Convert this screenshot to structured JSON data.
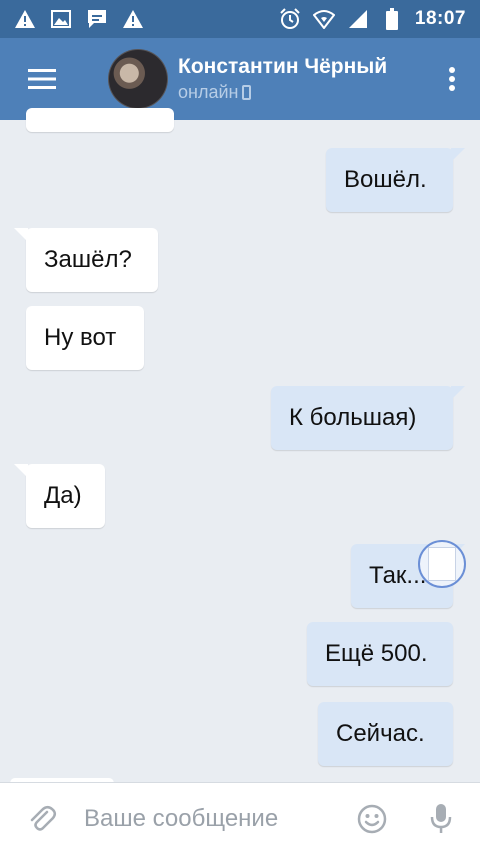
{
  "status_bar": {
    "time": "18:07",
    "left_icons": [
      "warning-icon",
      "image-icon",
      "message-icon",
      "warning-icon"
    ],
    "right_icons": [
      "alarm-icon",
      "wifi-icon",
      "signal-icon",
      "battery-icon"
    ]
  },
  "header": {
    "contact_name": "Константин Чёрный",
    "status": "онлайн",
    "background": "#4e80b8",
    "status_bar_color": "#3a6a9c"
  },
  "messages": [
    {
      "text": "Вошёл.",
      "direction": "out"
    },
    {
      "text": "Зашёл?",
      "direction": "in"
    },
    {
      "text": "Ну вот",
      "direction": "in"
    },
    {
      "text": "К большая)",
      "direction": "out"
    },
    {
      "text": "Да)",
      "direction": "in"
    },
    {
      "text": "Так...",
      "direction": "out"
    },
    {
      "text": "Ещё 500.",
      "direction": "out"
    },
    {
      "text": "Сейчас.",
      "direction": "out"
    }
  ],
  "input": {
    "placeholder": "Ваше сообщение"
  },
  "colors": {
    "chat_background": "#e9edf2",
    "incoming_bubble": "#ffffff",
    "outgoing_bubble": "#d9e6f6"
  }
}
